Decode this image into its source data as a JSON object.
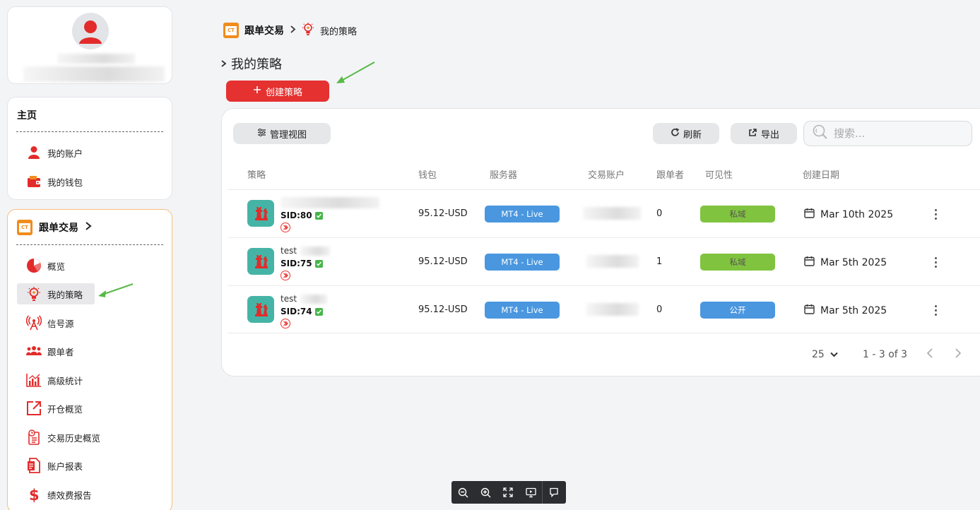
{
  "sidebar": {
    "home_section": {
      "title": "主页",
      "items": [
        {
          "label": "我的账户",
          "icon": "user-icon"
        },
        {
          "label": "我的钱包",
          "icon": "wallet-icon"
        }
      ]
    },
    "copy_section": {
      "title": "跟单交易",
      "items": [
        {
          "label": "概览",
          "icon": "pie-chart-icon"
        },
        {
          "label": "我的策略",
          "icon": "lightbulb-icon",
          "active": true
        },
        {
          "label": "信号源",
          "icon": "signal-tower-icon"
        },
        {
          "label": "跟单者",
          "icon": "users-icon"
        },
        {
          "label": "高级统计",
          "icon": "bar-chart-icon"
        },
        {
          "label": "开仓概览",
          "icon": "external-link-icon"
        },
        {
          "label": "交易历史概览",
          "icon": "history-clipboard-icon"
        },
        {
          "label": "账户报表",
          "icon": "report-document-icon"
        },
        {
          "label": "绩效费报告",
          "icon": "dollar-icon"
        }
      ]
    }
  },
  "breadcrumb": {
    "root": "跟单交易",
    "current": "我的策略"
  },
  "page": {
    "title": "我的策略",
    "create_button": "创建策略"
  },
  "toolbar": {
    "manage_view": "管理视图",
    "refresh": "刷新",
    "export": "导出",
    "search_placeholder": "搜索..."
  },
  "table": {
    "headers": [
      "策略",
      "钱包",
      "服务器",
      "交易账户",
      "跟单者",
      "可见性",
      "创建日期"
    ],
    "rows": [
      {
        "name": "",
        "sid": "SID:80",
        "wallet": "95.12-USD",
        "server": "MT4 - Live",
        "followers": "0",
        "visibility": "私域",
        "visibility_type": "private",
        "date": "Mar 10th 2025"
      },
      {
        "name": "test",
        "sid": "SID:75",
        "wallet": "95.12-USD",
        "server": "MT4 - Live",
        "followers": "1",
        "visibility": "私域",
        "visibility_type": "private",
        "date": "Mar 5th 2025"
      },
      {
        "name": "test",
        "sid": "SID:74",
        "wallet": "95.12-USD",
        "server": "MT4 - Live",
        "followers": "0",
        "visibility": "公开",
        "visibility_type": "public",
        "date": "Mar 5th 2025"
      }
    ]
  },
  "pagination": {
    "per_page": "25",
    "range": "1 - 3 of 3"
  },
  "colors": {
    "accent_red": "#e53130",
    "server_blue": "#4a97e0",
    "private_green": "#80c33f",
    "strategy_teal": "#45b4a6"
  }
}
